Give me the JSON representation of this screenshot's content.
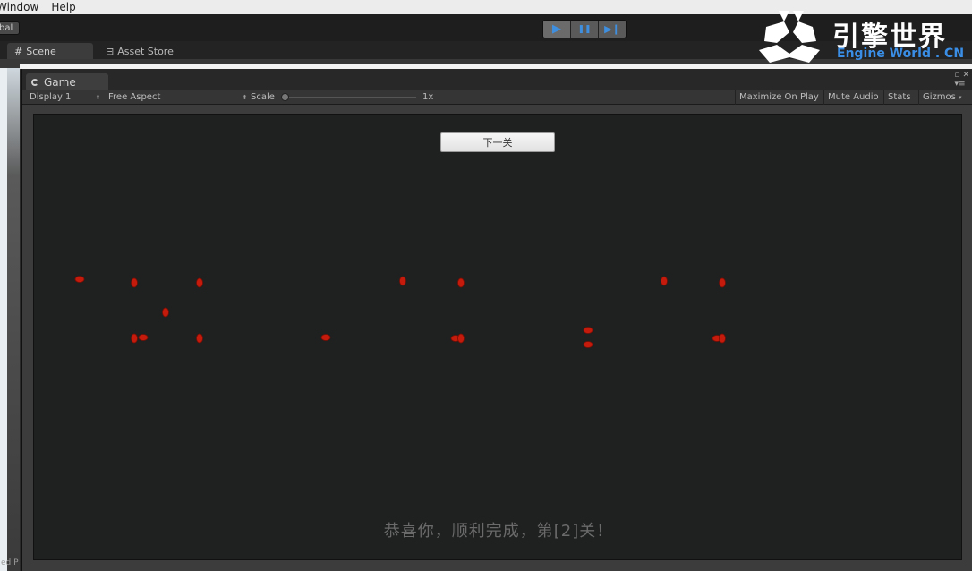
{
  "menu": {
    "items": [
      "Window",
      "Help"
    ]
  },
  "toolbar": {
    "global_label": "bal",
    "play_icons": [
      "play-icon",
      "pause-icon",
      "step-icon"
    ],
    "play_glyphs": [
      "▶",
      "❚❚",
      "▶❙"
    ]
  },
  "logo": {
    "cn": "引擎世界",
    "en": "Engine World . CN",
    "en_color": "#3a8ee6"
  },
  "scene_tabs": {
    "scene": "Scene",
    "asset_store": "Asset Store"
  },
  "bottom_left": {
    "text": "ed P"
  },
  "game": {
    "tab_label": "Game",
    "display": "Display 1",
    "aspect": "Free Aspect",
    "scale_label": "Scale",
    "scale_value": "1x",
    "buttons": [
      "Maximize On Play",
      "Mute Audio",
      "Stats",
      "Gizmos"
    ]
  },
  "level": {
    "next_button": "下一关",
    "congrats": "恭喜你，顺利完成，第[2]关！",
    "stick_color": "#d9a93b",
    "head_color": "#c41b0c"
  }
}
